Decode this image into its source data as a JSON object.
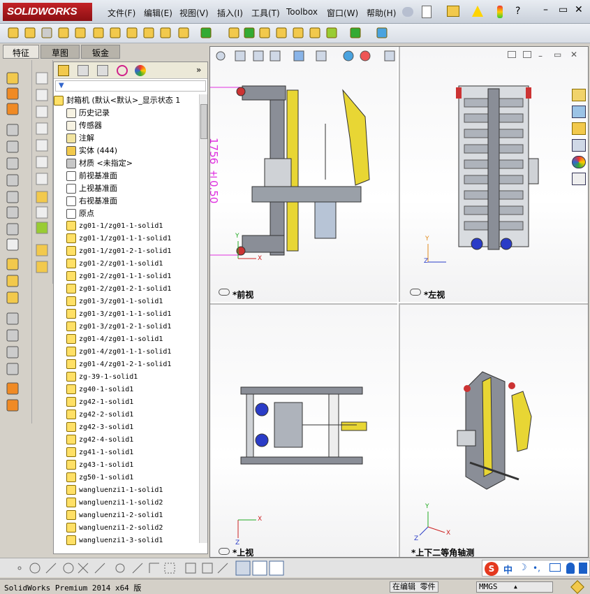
{
  "app": {
    "logo": "SOLIDWORKS"
  },
  "menu": [
    "文件(F)",
    "编辑(E)",
    "视图(V)",
    "插入(I)",
    "工具(T)",
    "Toolbox",
    "窗口(W)",
    "帮助(H)"
  ],
  "window_controls": {
    "minimize": "–",
    "restore": "▭",
    "close": "✕"
  },
  "fm_tabs": [
    "特征",
    "草图",
    "钣金"
  ],
  "tree": {
    "root": "封箱机 (默认<默认>_显示状态 1",
    "nodes": [
      "历史记录",
      "传感器",
      "注解",
      "实体 (444)",
      "材质 <未指定>",
      "前视基准面",
      "上视基准面",
      "右视基准面",
      "原点"
    ],
    "parts": [
      "zg01-1/zg01-1-solid1",
      "zg01-1/zg01-1-1-solid1",
      "zg01-1/zg01-2-1-solid1",
      "zg01-2/zg01-1-solid1",
      "zg01-2/zg01-1-1-solid1",
      "zg01-2/zg01-2-1-solid1",
      "zg01-3/zg01-1-solid1",
      "zg01-3/zg01-1-1-solid1",
      "zg01-3/zg01-2-1-solid1",
      "zg01-4/zg01-1-solid1",
      "zg01-4/zg01-1-1-solid1",
      "zg01-4/zg01-2-1-solid1",
      "zg-39-1-solid1",
      "zg40-1-solid1",
      "zg42-1-solid1",
      "zg42-2-solid1",
      "zg42-3-solid1",
      "zg42-4-solid1",
      "zg41-1-solid1",
      "zg43-1-solid1",
      "zg50-1-solid1",
      "wangluenzi1-1-solid1",
      "wangluenzi1-1-solid2",
      "wangluenzi1-2-solid1",
      "wangluenzi1-2-solid2",
      "wangluenzi1-3-solid1"
    ]
  },
  "views": {
    "front": "*前视",
    "left": "*左视",
    "top": "*上视",
    "iso": "*上下二等角轴测"
  },
  "dimension": "1756 ±0.50",
  "axis": {
    "x": "X",
    "y": "Y",
    "z": "Z"
  },
  "status": {
    "version": "SolidWorks Premium 2014 x64 版",
    "mode": "在编辑 零件",
    "units": "MMGS"
  },
  "ime": {
    "lang": "中"
  },
  "colors": {
    "brand": "#c32226",
    "dimension": "#e030e0",
    "frame": "#8a8e97",
    "accent": "#e8d634"
  }
}
